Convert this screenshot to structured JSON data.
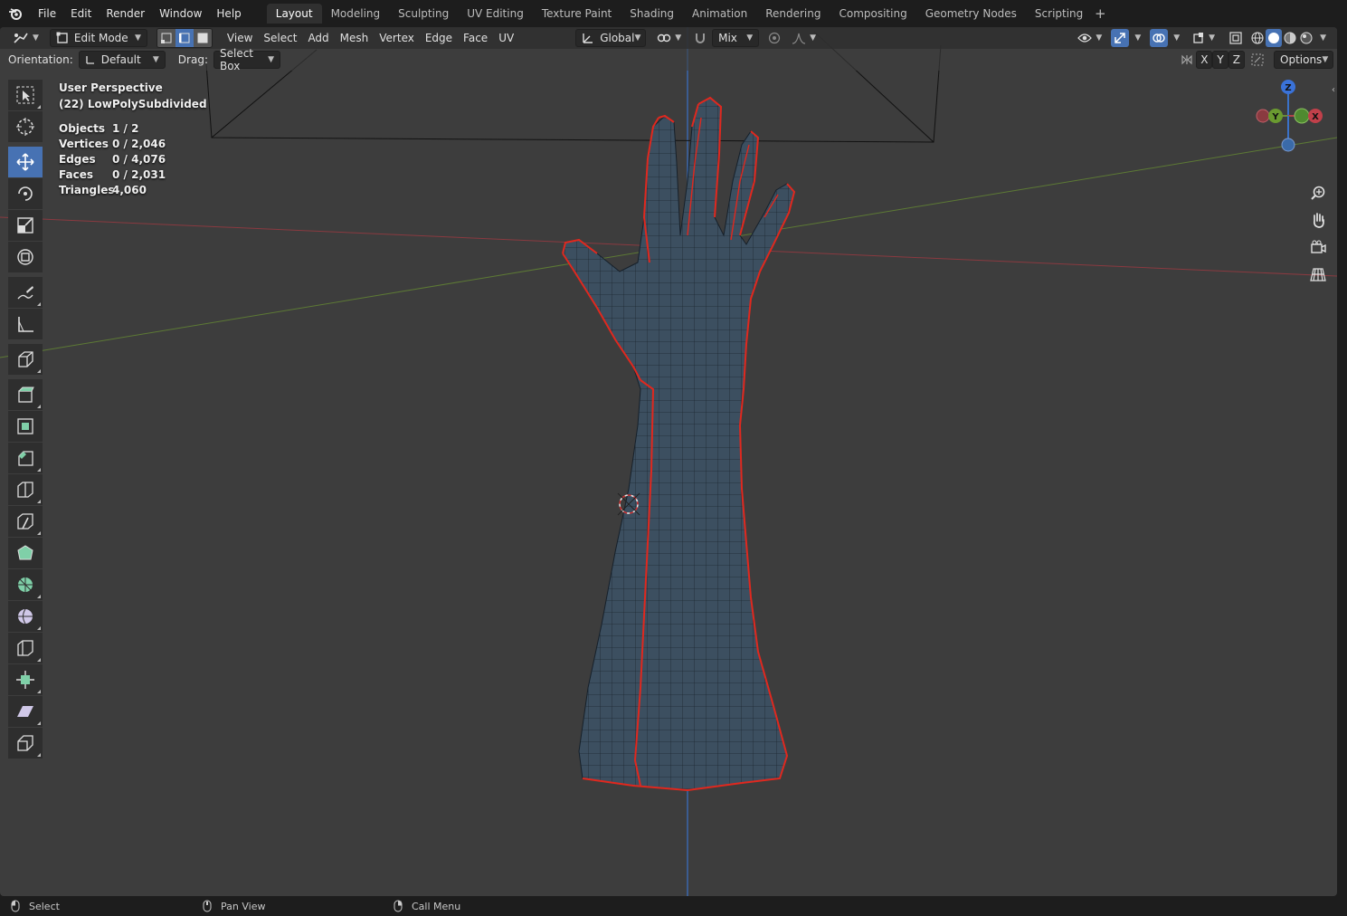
{
  "menu": {
    "items": [
      "File",
      "Edit",
      "Render",
      "Window",
      "Help"
    ]
  },
  "workspaces": {
    "tabs": [
      "Layout",
      "Modeling",
      "Sculpting",
      "UV Editing",
      "Texture Paint",
      "Shading",
      "Animation",
      "Rendering",
      "Compositing",
      "Geometry Nodes",
      "Scripting"
    ],
    "active": "Layout",
    "add_label": "+"
  },
  "header": {
    "mode": "Edit Mode",
    "menus": [
      "View",
      "Select",
      "Add",
      "Mesh",
      "Vertex",
      "Edge",
      "Face",
      "UV"
    ],
    "transform_orientation": "Global",
    "proportional_falloff": "Mix",
    "axis_x": "X",
    "axis_y": "Y",
    "axis_z": "Z",
    "options_label": "Options"
  },
  "tool_settings": {
    "orientation_label": "Orientation:",
    "orientation_value": "Default",
    "drag_label": "Drag:",
    "drag_value": "Select Box"
  },
  "overlay": {
    "perspective": "User Perspective",
    "object": "(22) LowPolySubdivided",
    "stats": [
      {
        "key": "Objects",
        "value": "1 / 2"
      },
      {
        "key": "Vertices",
        "value": "0 / 2,046"
      },
      {
        "key": "Edges",
        "value": "0 / 4,076"
      },
      {
        "key": "Faces",
        "value": "0 / 2,031"
      },
      {
        "key": "Triangles",
        "value": "4,060"
      }
    ]
  },
  "gizmo": {
    "z": "Z",
    "y": "Y",
    "x": "X"
  },
  "statusbar": {
    "select": "Select",
    "pan": "Pan View",
    "menu": "Call Menu"
  },
  "colors": {
    "viewport_bg": "#3d3d3d",
    "active_blue": "#4772b3",
    "mesh_fill": "#3c4f60",
    "seam_red": "#e0281e",
    "axis_x": "#b0434b",
    "axis_y": "#6a8a3a",
    "axis_z": "#3a72c8"
  }
}
